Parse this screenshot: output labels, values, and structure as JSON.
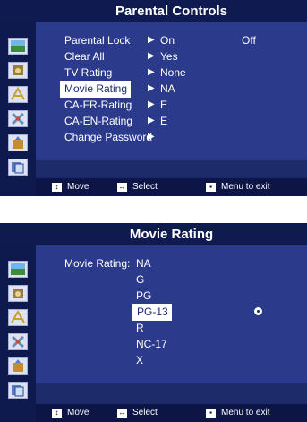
{
  "sidebar_icons": [
    "picture-icon",
    "sound-icon",
    "channel-icon",
    "setup-icon",
    "input-icon",
    "application-icon"
  ],
  "parental_controls": {
    "title": "Parental Controls",
    "items": [
      {
        "label": "Parental Lock",
        "value": "On",
        "extra": "Off"
      },
      {
        "label": "Clear All",
        "value": "Yes"
      },
      {
        "label": "TV Rating",
        "value": "None"
      },
      {
        "label": "Movie Rating",
        "value": "NA"
      },
      {
        "label": "CA-FR-Rating",
        "value": "E"
      },
      {
        "label": "CA-EN-Rating",
        "value": "E"
      },
      {
        "label": "Change Password",
        "value": ""
      }
    ],
    "selected_index": 3
  },
  "movie_rating": {
    "title": "Movie Rating",
    "label": "Movie Rating:",
    "options": [
      "NA",
      "G",
      "PG",
      "PG-13",
      "R",
      "NC-17",
      "X"
    ],
    "selected_index": 3
  },
  "footer": {
    "move": "Move",
    "select": "Select",
    "exit": "Menu to exit"
  }
}
